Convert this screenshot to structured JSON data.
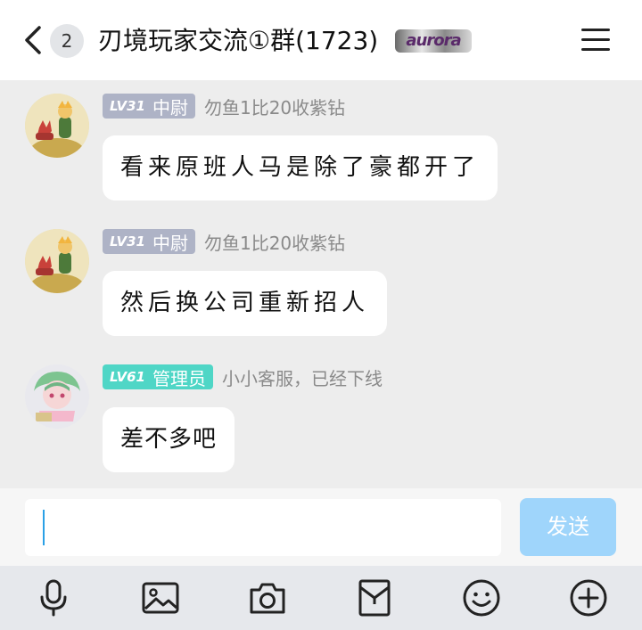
{
  "header": {
    "unread_count": "2",
    "title": "刃境玩家交流①群(1723)",
    "brand_badge": "aurora"
  },
  "messages": [
    {
      "level": "LV31",
      "rank": "中尉",
      "nickname": "勿鱼1比20收紫钻",
      "text": "看来原班人马是除了豪都开了",
      "badge_color": "#aeb3c6"
    },
    {
      "level": "LV31",
      "rank": "中尉",
      "nickname": "勿鱼1比20收紫钻",
      "text": "然后换公司重新招人",
      "badge_color": "#aeb3c6"
    },
    {
      "level": "LV61",
      "rank": "管理员",
      "nickname": "小小客服，已经下线",
      "text": "差不多吧",
      "badge_color": "#4fd6c6"
    }
  ],
  "composer": {
    "send_label": "发送",
    "input_value": ""
  },
  "toolbar": {
    "icons": [
      "microphone-icon",
      "image-icon",
      "camera-icon",
      "red-packet-icon",
      "emoji-icon",
      "plus-icon"
    ]
  },
  "colors": {
    "accent_send": "#9fd5fb",
    "caret": "#2aa0e6",
    "admin_badge": "#4fd6c6",
    "member_badge": "#aeb3c6"
  }
}
